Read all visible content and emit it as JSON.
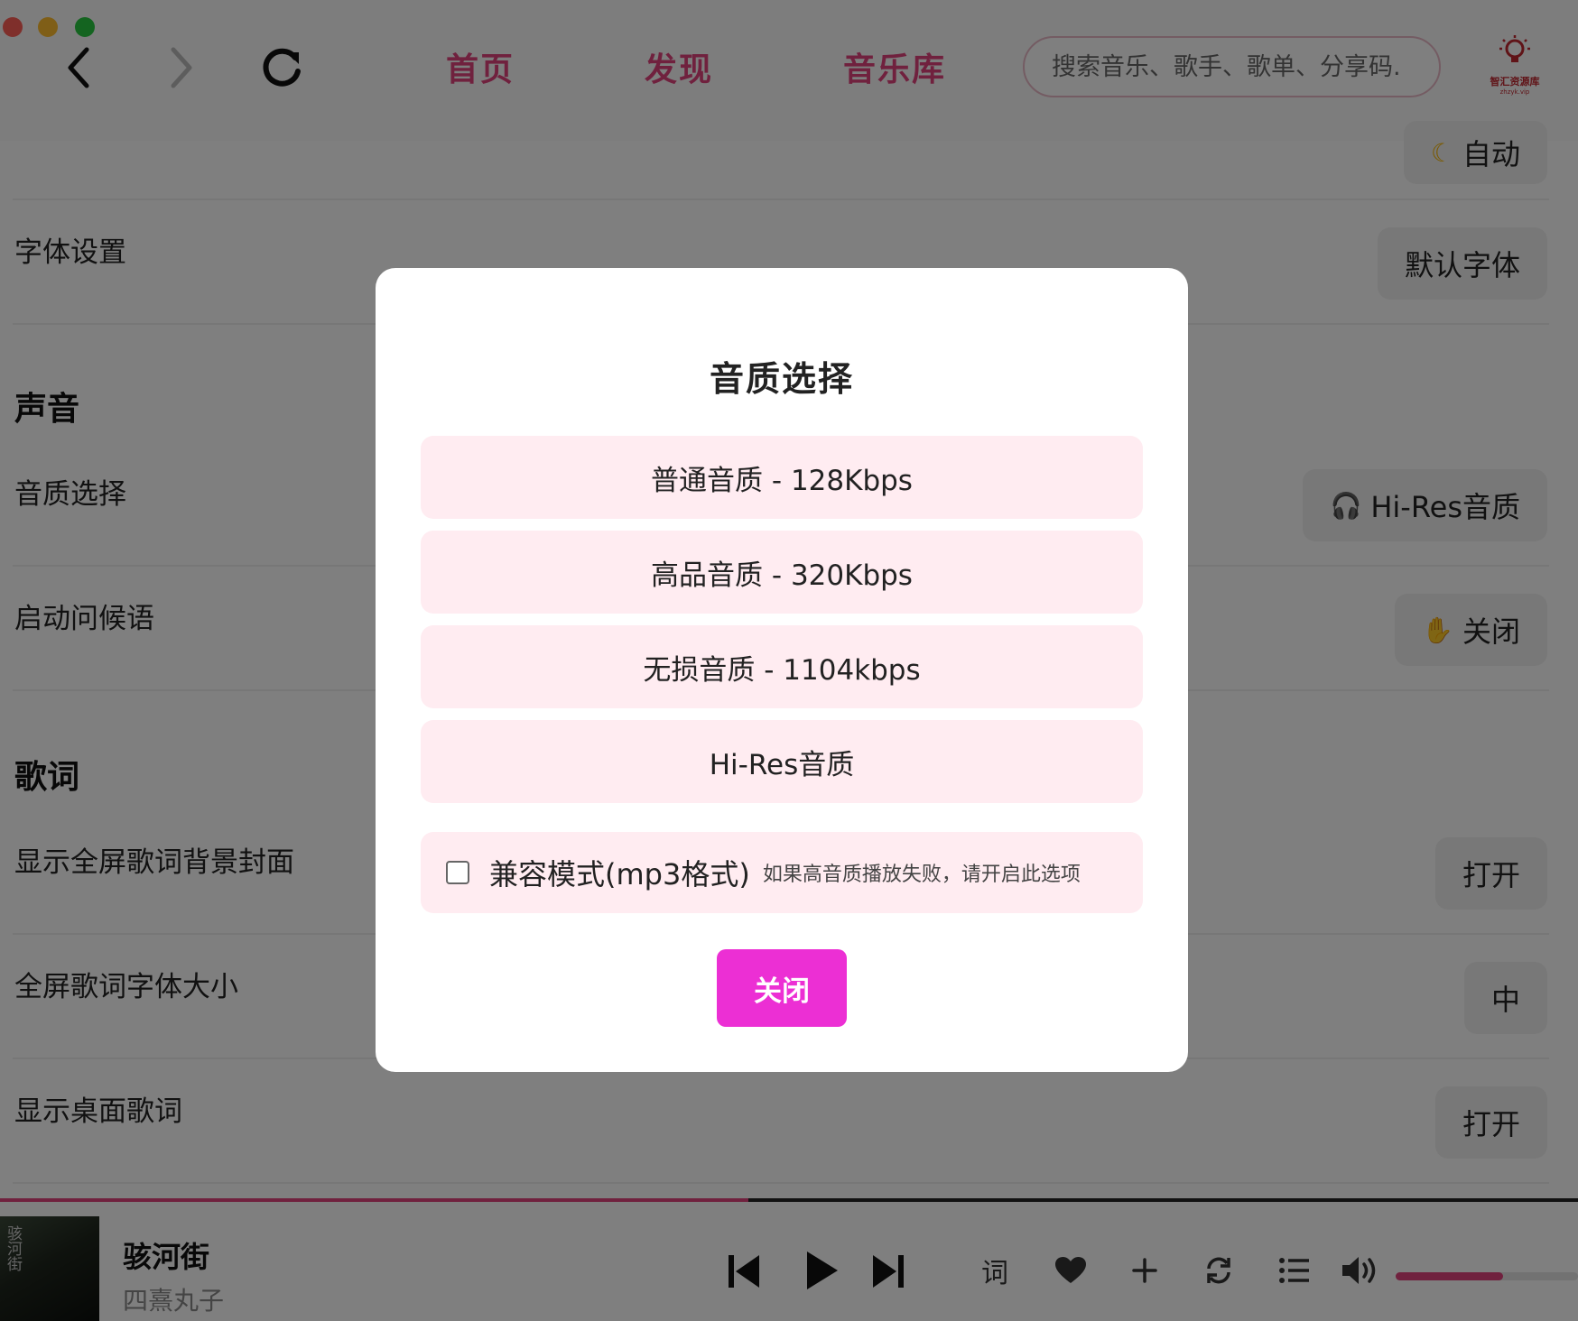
{
  "nav": {
    "links": [
      "首页",
      "发现",
      "音乐库"
    ],
    "search_placeholder": "搜索音乐、歌手、歌单、分享码.",
    "logo_text": "智汇资源库",
    "logo_sub": "zhzyk.vip"
  },
  "settings": {
    "theme_value": "自动",
    "font_label": "字体设置",
    "font_value": "默认字体",
    "sound_section": "声音",
    "quality_label": "音质选择",
    "quality_value": "Hi-Res音质",
    "greeting_label": "启动问候语",
    "greeting_value": "关闭",
    "lyrics_section": "歌词",
    "fullscreen_cover_label": "显示全屏歌词背景封面",
    "fullscreen_cover_value": "打开",
    "fullscreen_font_label": "全屏歌词字体大小",
    "fullscreen_font_value": "中",
    "desktop_lyrics_label": "显示桌面歌词",
    "desktop_lyrics_value": "打开"
  },
  "player": {
    "cover_text": "骇河街",
    "song_title": "骇河街",
    "artist": "四熹丸子",
    "lyrics_button": "词",
    "progress": 0.474,
    "volume": 0.59
  },
  "modal": {
    "title": "音质选择",
    "options": [
      "普通音质 - 128Kbps",
      "高品音质 - 320Kbps",
      "无损音质 - 1104kbps",
      "Hi-Res音质"
    ],
    "compat_label": "兼容模式(mp3格式)",
    "compat_hint": "如果高音质播放失败，请开启此选项",
    "compat_checked": false,
    "close_label": "关闭"
  },
  "colors": {
    "accent": "#e0437c",
    "close_button": "#ec2fd4",
    "option_bg": "#ffecf1"
  }
}
